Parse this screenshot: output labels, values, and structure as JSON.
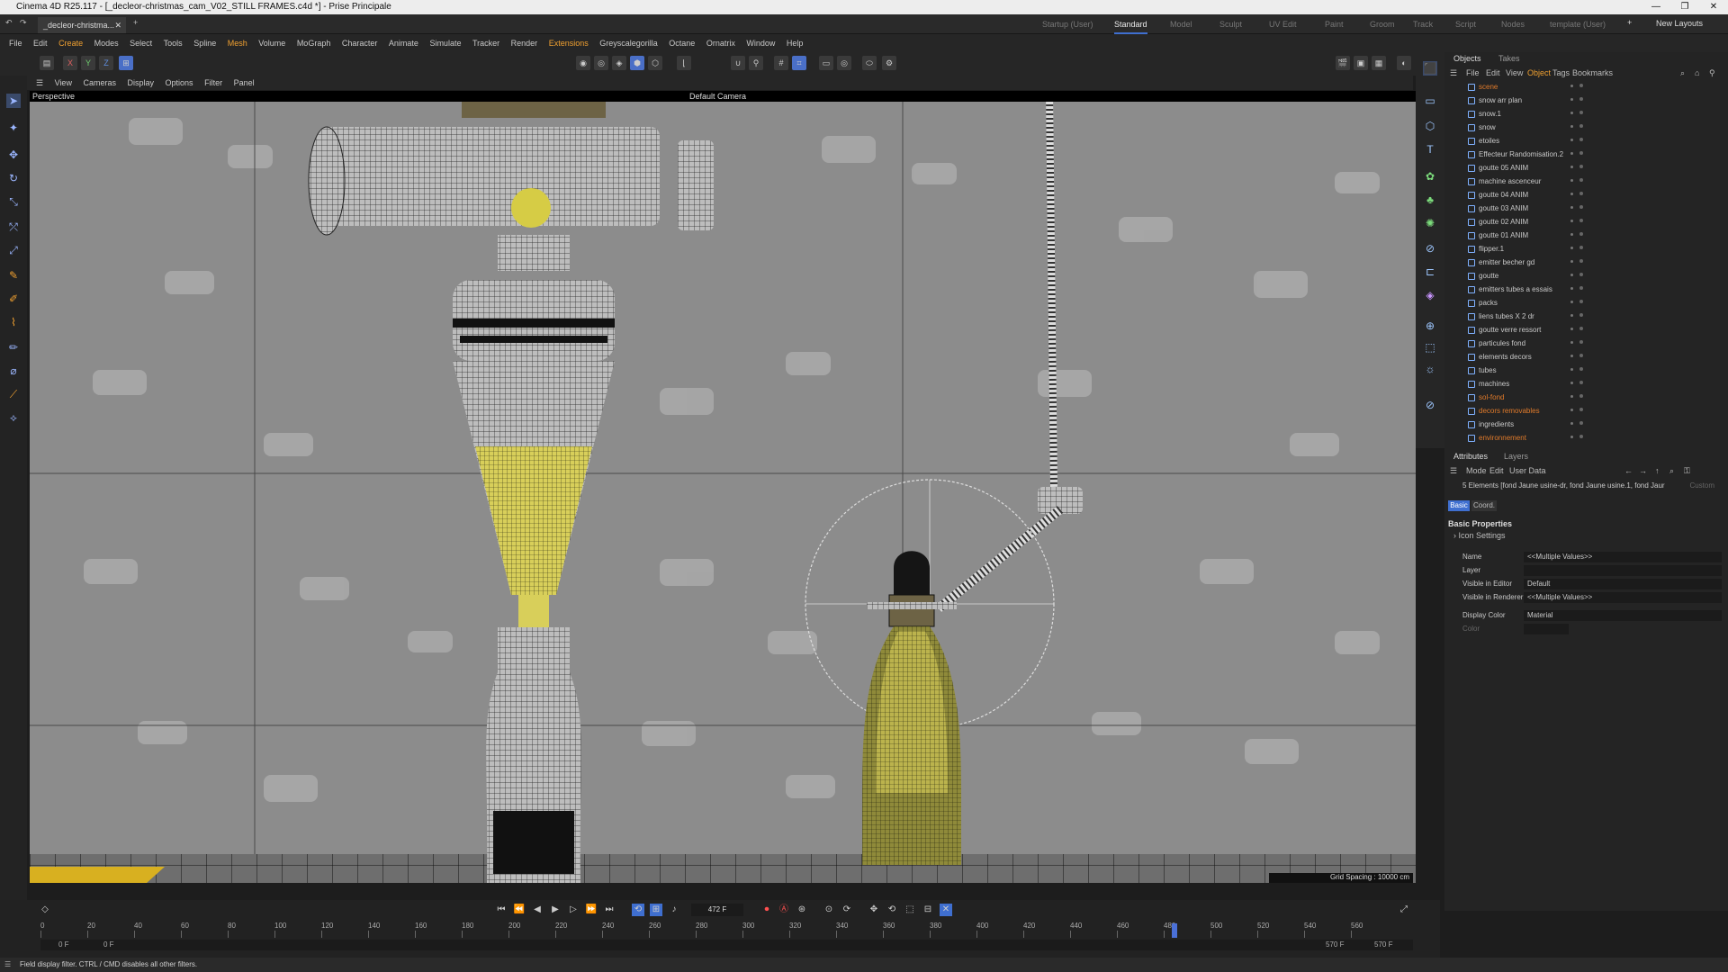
{
  "app": {
    "title": "Cinema 4D R25.117 - [_decleor-christmas_cam_V02_STILL FRAMES.c4d *] - Prise Principale"
  },
  "file_tab": "_decleor-christma...",
  "layout_tabs": [
    "Startup (User)",
    "Standard",
    "Model",
    "Sculpt",
    "UV Edit",
    "Paint",
    "Groom",
    "Track",
    "Script",
    "Nodes",
    "template (User)"
  ],
  "active_layout": "Standard",
  "new_layouts": "New Layouts",
  "menu": [
    "File",
    "Edit",
    "Create",
    "Modes",
    "Select",
    "Tools",
    "Spline",
    "Mesh",
    "Volume",
    "MoGraph",
    "Character",
    "Animate",
    "Simulate",
    "Tracker",
    "Render",
    "Extensions",
    "Greyscalegorilla",
    "Octane",
    "Ornatrix",
    "Window",
    "Help"
  ],
  "axis_buttons": [
    "X",
    "Y",
    "Z"
  ],
  "viewport_menu": [
    "View",
    "Cameras",
    "Display",
    "Options",
    "Filter",
    "Panel"
  ],
  "viewport": {
    "label": "Perspective",
    "camera": "Default Camera",
    "grid_spacing": "Grid Spacing : 10000 cm"
  },
  "objects_panel": {
    "tabs": [
      "Objects",
      "Takes"
    ],
    "menu": [
      "File",
      "Edit",
      "View",
      "Object",
      "Tags",
      "Bookmarks"
    ],
    "items": [
      {
        "name": "scene",
        "color": "#e07a2a"
      },
      {
        "name": "snow arr plan"
      },
      {
        "name": "snow.1"
      },
      {
        "name": "snow"
      },
      {
        "name": "etoiles"
      },
      {
        "name": "Effecteur Randomisation.2"
      },
      {
        "name": "goutte 05 ANIM"
      },
      {
        "name": "machine ascenceur"
      },
      {
        "name": "goutte 04 ANIM"
      },
      {
        "name": "goutte 03 ANIM"
      },
      {
        "name": "goutte 02 ANIM"
      },
      {
        "name": "goutte 01 ANIM"
      },
      {
        "name": "flipper.1"
      },
      {
        "name": "emitter becher gd"
      },
      {
        "name": "goutte"
      },
      {
        "name": "emitters tubes a essais"
      },
      {
        "name": "packs"
      },
      {
        "name": "liens tubes X 2 dr"
      },
      {
        "name": "goutte verre ressort"
      },
      {
        "name": "particules fond"
      },
      {
        "name": "elements decors"
      },
      {
        "name": "tubes"
      },
      {
        "name": "machines"
      },
      {
        "name": "sol-fond",
        "color": "#e07a2a"
      },
      {
        "name": "decors removables",
        "color": "#e07a2a"
      },
      {
        "name": "ingredients"
      },
      {
        "name": "environnement",
        "color": "#e07a2a"
      }
    ]
  },
  "attributes_panel": {
    "tabs": [
      "Attributes",
      "Layers"
    ],
    "menu": [
      "Mode",
      "Edit",
      "User Data"
    ],
    "selection": "5 Elements [fond  Jaune usine-dr, fond  Jaune usine.1, fond  Jaur",
    "custom": "Custom",
    "subtabs": [
      "Basic",
      "Coord."
    ],
    "section": "Basic Properties",
    "icon_settings": "Icon Settings",
    "rows": [
      {
        "label": "Name",
        "value": "<<Multiple Values>>"
      },
      {
        "label": "Layer",
        "value": ""
      },
      {
        "label": "Visible in Editor",
        "value": "Default"
      },
      {
        "label": "Visible in Renderer",
        "value": "<<Multiple Values>>"
      },
      {
        "label": "Display Color",
        "value": "Material"
      },
      {
        "label": "Color",
        "value": ""
      }
    ]
  },
  "timeline": {
    "current_frame": "472 F",
    "ticks": [
      "0",
      "20",
      "40",
      "60",
      "80",
      "100",
      "120",
      "140",
      "160",
      "180",
      "200",
      "220",
      "240",
      "260",
      "280",
      "300",
      "320",
      "340",
      "360",
      "380",
      "400",
      "420",
      "440",
      "460",
      "480",
      "500",
      "520",
      "540",
      "560"
    ],
    "start": "0 F",
    "start2": "0 F",
    "end1": "570 F",
    "end2": "570 F"
  },
  "status": "Field display filter. CTRL / CMD disables all other filters."
}
